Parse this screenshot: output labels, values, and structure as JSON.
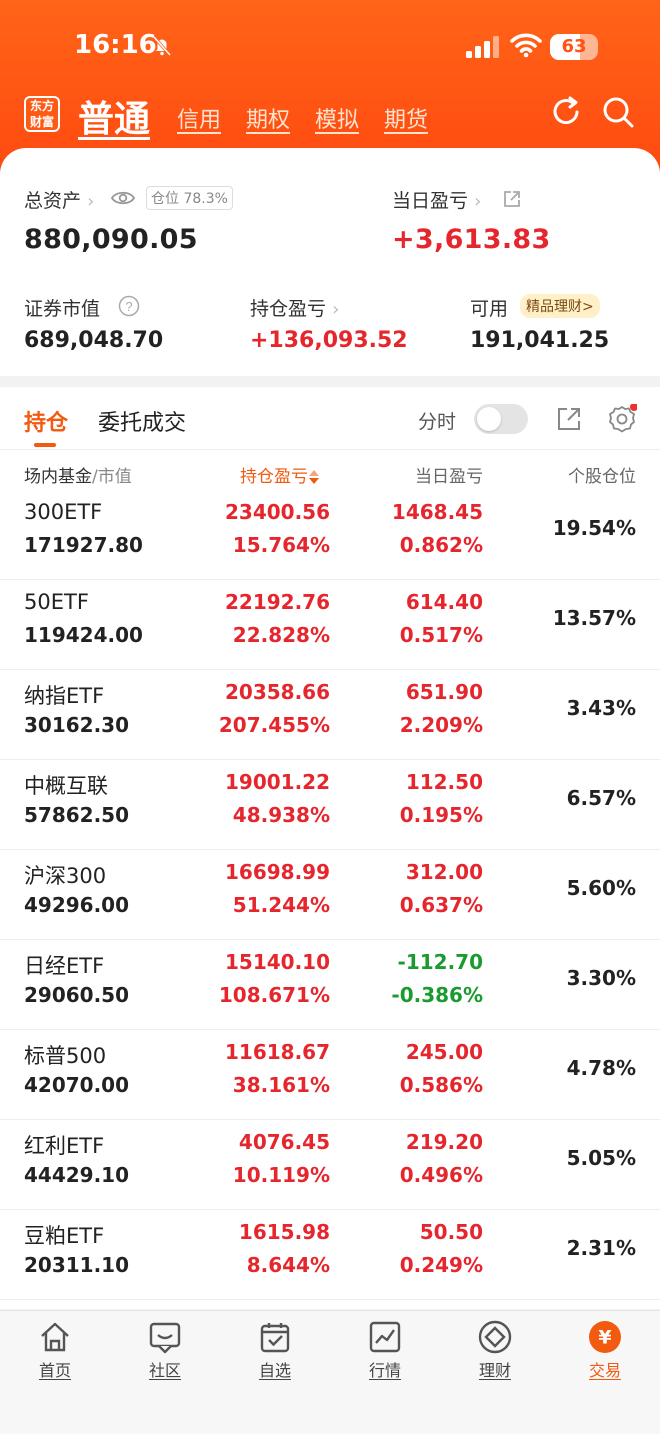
{
  "status_bar": {
    "time": "16:16",
    "battery": "63"
  },
  "nav": {
    "logo_line1": "东方",
    "logo_line2": "财富",
    "active_tab": "普通",
    "tabs": [
      "信用",
      "期权",
      "模拟",
      "期货"
    ]
  },
  "summary": {
    "total_assets_label": "总资产",
    "position_ratio": "仓位 78.3%",
    "total_assets": "880,090.05",
    "daily_pl_label": "当日盈亏",
    "daily_pl": "+3,613.83",
    "market_value_label": "证券市值",
    "market_value": "689,048.70",
    "holding_pl_label": "持仓盈亏",
    "holding_pl": "+136,093.52",
    "available_label": "可用",
    "available": "191,041.25",
    "wealth_badge": "精品理财>"
  },
  "holdings": {
    "tab_active": "持仓",
    "tab_other": "委托成交",
    "time_share_label": "分时",
    "headers": {
      "name": "场内基金",
      "name_sub": "/市值",
      "holding_pl": "持仓盈亏",
      "daily_pl": "当日盈亏",
      "weight": "个股仓位"
    },
    "rows": [
      {
        "name": "300ETF",
        "market_value": "171927.80",
        "holding_pl": "23400.56",
        "holding_pl_pct": "15.764%",
        "daily_pl": "1468.45",
        "daily_pl_pct": "0.862%",
        "weight": "19.54%",
        "daily_dir": "up"
      },
      {
        "name": "50ETF",
        "market_value": "119424.00",
        "holding_pl": "22192.76",
        "holding_pl_pct": "22.828%",
        "daily_pl": "614.40",
        "daily_pl_pct": "0.517%",
        "weight": "13.57%",
        "daily_dir": "up"
      },
      {
        "name": "纳指ETF",
        "market_value": "30162.30",
        "holding_pl": "20358.66",
        "holding_pl_pct": "207.455%",
        "daily_pl": "651.90",
        "daily_pl_pct": "2.209%",
        "weight": "3.43%",
        "daily_dir": "up"
      },
      {
        "name": "中概互联",
        "market_value": "57862.50",
        "holding_pl": "19001.22",
        "holding_pl_pct": "48.938%",
        "daily_pl": "112.50",
        "daily_pl_pct": "0.195%",
        "weight": "6.57%",
        "daily_dir": "up"
      },
      {
        "name": "沪深300",
        "market_value": "49296.00",
        "holding_pl": "16698.99",
        "holding_pl_pct": "51.244%",
        "daily_pl": "312.00",
        "daily_pl_pct": "0.637%",
        "weight": "5.60%",
        "daily_dir": "up"
      },
      {
        "name": "日经ETF",
        "market_value": "29060.50",
        "holding_pl": "15140.10",
        "holding_pl_pct": "108.671%",
        "daily_pl": "-112.70",
        "daily_pl_pct": "-0.386%",
        "weight": "3.30%",
        "daily_dir": "down"
      },
      {
        "name": "标普500",
        "market_value": "42070.00",
        "holding_pl": "11618.67",
        "holding_pl_pct": "38.161%",
        "daily_pl": "245.00",
        "daily_pl_pct": "0.586%",
        "weight": "4.78%",
        "daily_dir": "up"
      },
      {
        "name": "红利ETF",
        "market_value": "44429.10",
        "holding_pl": "4076.45",
        "holding_pl_pct": "10.119%",
        "daily_pl": "219.20",
        "daily_pl_pct": "0.496%",
        "weight": "5.05%",
        "daily_dir": "up"
      },
      {
        "name": "豆粕ETF",
        "market_value": "20311.10",
        "holding_pl": "1615.98",
        "holding_pl_pct": "8.644%",
        "daily_pl": "50.50",
        "daily_pl_pct": "0.249%",
        "weight": "2.31%",
        "daily_dir": "up"
      }
    ]
  },
  "bottom_nav": [
    {
      "label": "首页",
      "icon": "home-icon"
    },
    {
      "label": "社区",
      "icon": "community-icon"
    },
    {
      "label": "自选",
      "icon": "watchlist-icon"
    },
    {
      "label": "行情",
      "icon": "market-icon"
    },
    {
      "label": "理财",
      "icon": "wealth-icon"
    },
    {
      "label": "交易",
      "icon": "trade-icon",
      "active": true
    }
  ],
  "colors": {
    "brand": "#ff5214",
    "up": "#e5262d",
    "down": "#1a9b2f",
    "accent": "#f25a10"
  }
}
